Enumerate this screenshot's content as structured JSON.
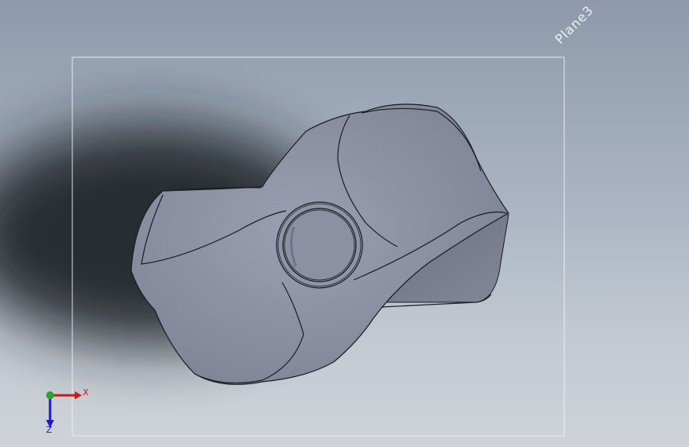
{
  "viewport": {
    "plane_label": "Plane3",
    "background_top": "#8e9aab",
    "background_bottom": "#cfd3d9",
    "model_color": "#8a90a2",
    "edge_color": "#1a1c22"
  },
  "triad": {
    "x_label": "X",
    "z_label": "Z",
    "x_color": "#cc1a1a",
    "y_color": "#2fa12f",
    "z_color": "#1a1acc"
  }
}
